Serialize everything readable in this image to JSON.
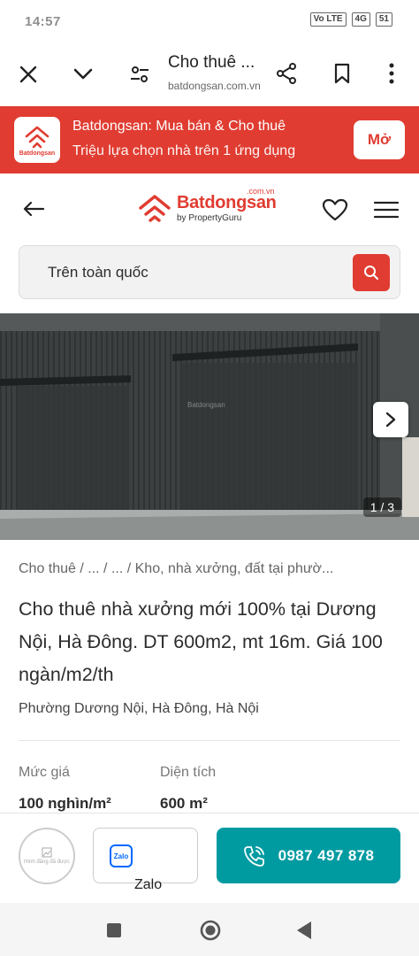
{
  "status": {
    "time": "14:57",
    "badges": [
      "Vo LTE",
      "4G",
      "51"
    ]
  },
  "browser": {
    "title": "Cho thuê ...",
    "url": "batdongsan.com.vn",
    "icons": [
      "close-icon",
      "chevron-down-icon",
      "tune-icon",
      "share-icon",
      "bookmark-icon",
      "more-vert-icon"
    ]
  },
  "app_banner": {
    "title": "Batdongsan: Mua bán & Cho thuê",
    "subtitle": "Triệu lựa chọn nhà trên 1 ứng dụng",
    "open_label": "Mở",
    "logo_text": "Batdongsan",
    "color": "#e03c31"
  },
  "site_header": {
    "brand": "Batdongsan",
    "brand_tld": ".com.vn",
    "brand_by": "by PropertyGuru"
  },
  "search": {
    "text": "Trên toàn quốc"
  },
  "gallery": {
    "counter": "1 / 3",
    "watermark": "Batdongsan"
  },
  "listing": {
    "breadcrumb": "Cho thuê / ... / ... / Kho, nhà xưởng, đất tại phườ...",
    "title": "Cho thuê nhà xưởng mới 100% tại Dương Nội, Hà Đông. DT 600m2, mt 16m. Giá 100 ngàn/m2/th",
    "address": "Phường Dương Nội, Hà Đông, Hà Nội",
    "price_label": "Mức giá",
    "price_value": "100 nghìn/m²",
    "area_label": "Diện tích",
    "area_value": "600 m²"
  },
  "contact": {
    "avatar_text": "Hình đăng đã được",
    "zalo_icon_text": "Zalo",
    "zalo_label": "Zalo",
    "phone": "0987 497 878",
    "call_color": "#009ba1"
  }
}
